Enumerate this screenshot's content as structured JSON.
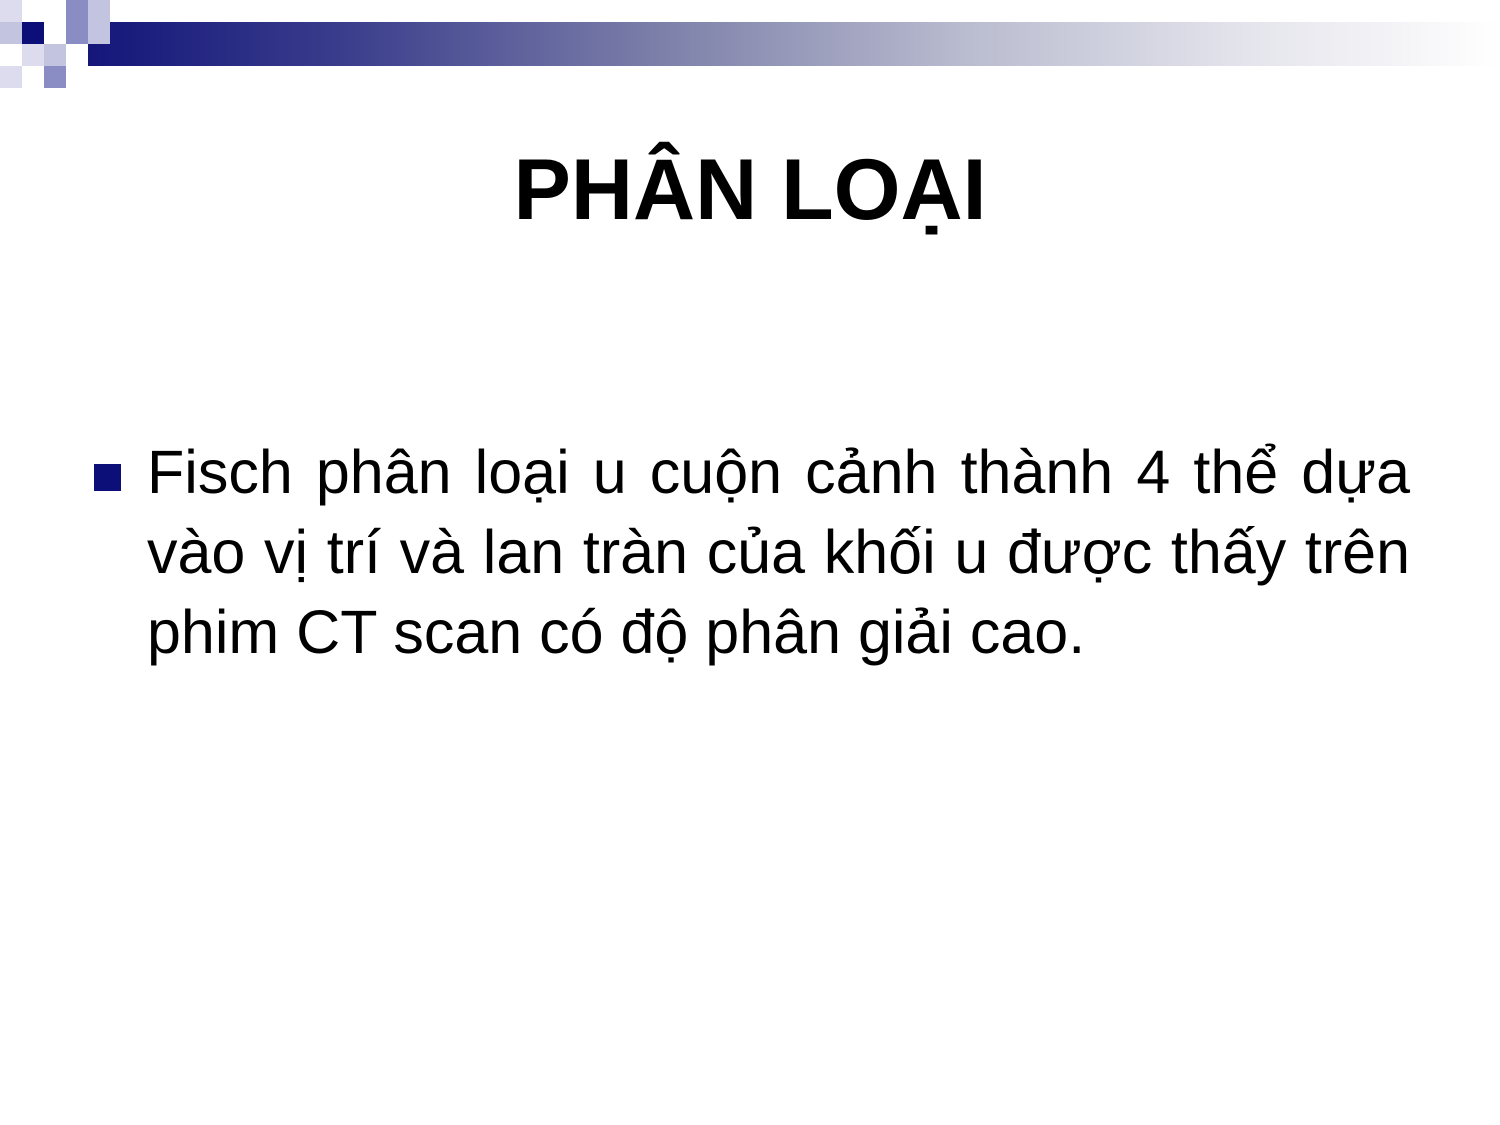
{
  "slide": {
    "title": "PHÂN LOẠI",
    "bullets": [
      {
        "text": "Fisch phân loại u cuộn cảnh thành 4 thể dựa vào vị trí và lan tràn của khối u được thấy trên phim CT scan có độ phân giải cao."
      }
    ]
  },
  "theme": {
    "accent": "#0d0f78",
    "band_start": "#14167a",
    "band_end": "#ffffff"
  }
}
